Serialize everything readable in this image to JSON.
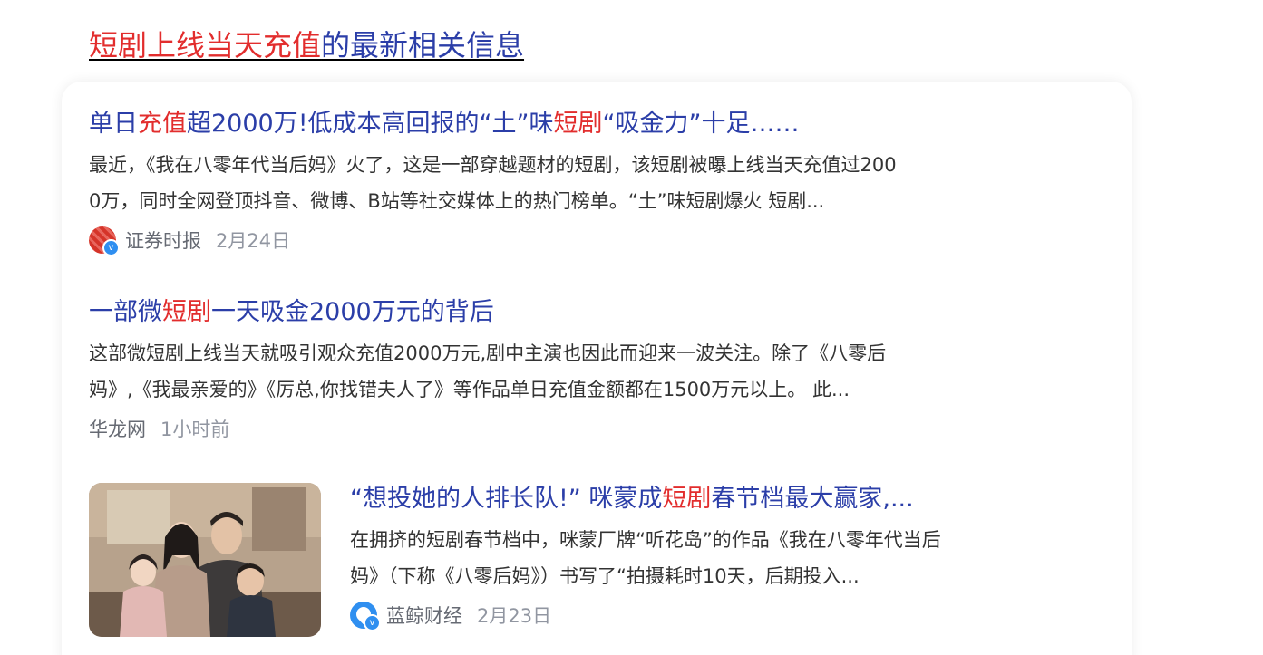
{
  "header": {
    "title_highlight": "短剧上线当天充值",
    "title_rest": "的最新相关信息"
  },
  "results": [
    {
      "title": {
        "p1": "单日",
        "k1": "充值",
        "p2": "超2000万!低成本高回报的“土”味",
        "k2": "短剧",
        "p3": "“吸金力”十足……"
      },
      "snippet_line1": "最近，《我在八零年代当后妈》火了，这是一部穿越题材的短剧，该短剧被曝上线当天充值过200",
      "snippet_line2": "0万，同时全网登顶抖音、微博、B站等社交媒体上的热门榜单。“土”味短剧爆火 短剧...",
      "source": "证券时报",
      "date": "2月24日",
      "icon": "zqsb-logo-icon",
      "verified_icon": "verified-badge-icon"
    },
    {
      "title": {
        "p1": "一部微",
        "k1": "短剧",
        "p2": "一天吸金2000万元的背后"
      },
      "snippet_line1": "这部微短剧上线当天就吸引观众充值2000万元,剧中主演也因此而迎来一波关注。除了《八零后",
      "snippet_line2": "妈》,《我最亲爱的》《厉总,你找错夫人了》等作品单日充值金额都在1500万元以上。 此...",
      "source": "华龙网",
      "date": "1小时前"
    },
    {
      "title": {
        "p1": "“想投她的人排长队!” 咪蒙成",
        "k1": "短剧",
        "p2": "春节档最大赢家,..."
      },
      "snippet_line1": "在拥挤的短剧春节档中，咪蒙厂牌“听花岛”的作品《我在八零年代当后",
      "snippet_line2": "妈》（下称《八零后妈》）书写了“拍摄耗时10天，后期投入...",
      "source": "蓝鲸财经",
      "date": "2月23日",
      "icon": "ljcj-logo-icon",
      "verified_icon": "verified-badge-icon",
      "thumbnail": "family-photo-thumbnail"
    }
  ],
  "colors": {
    "highlight": "#e22d2d",
    "link": "#2b3ea8",
    "text": "#333333",
    "meta": "#9196a1"
  }
}
